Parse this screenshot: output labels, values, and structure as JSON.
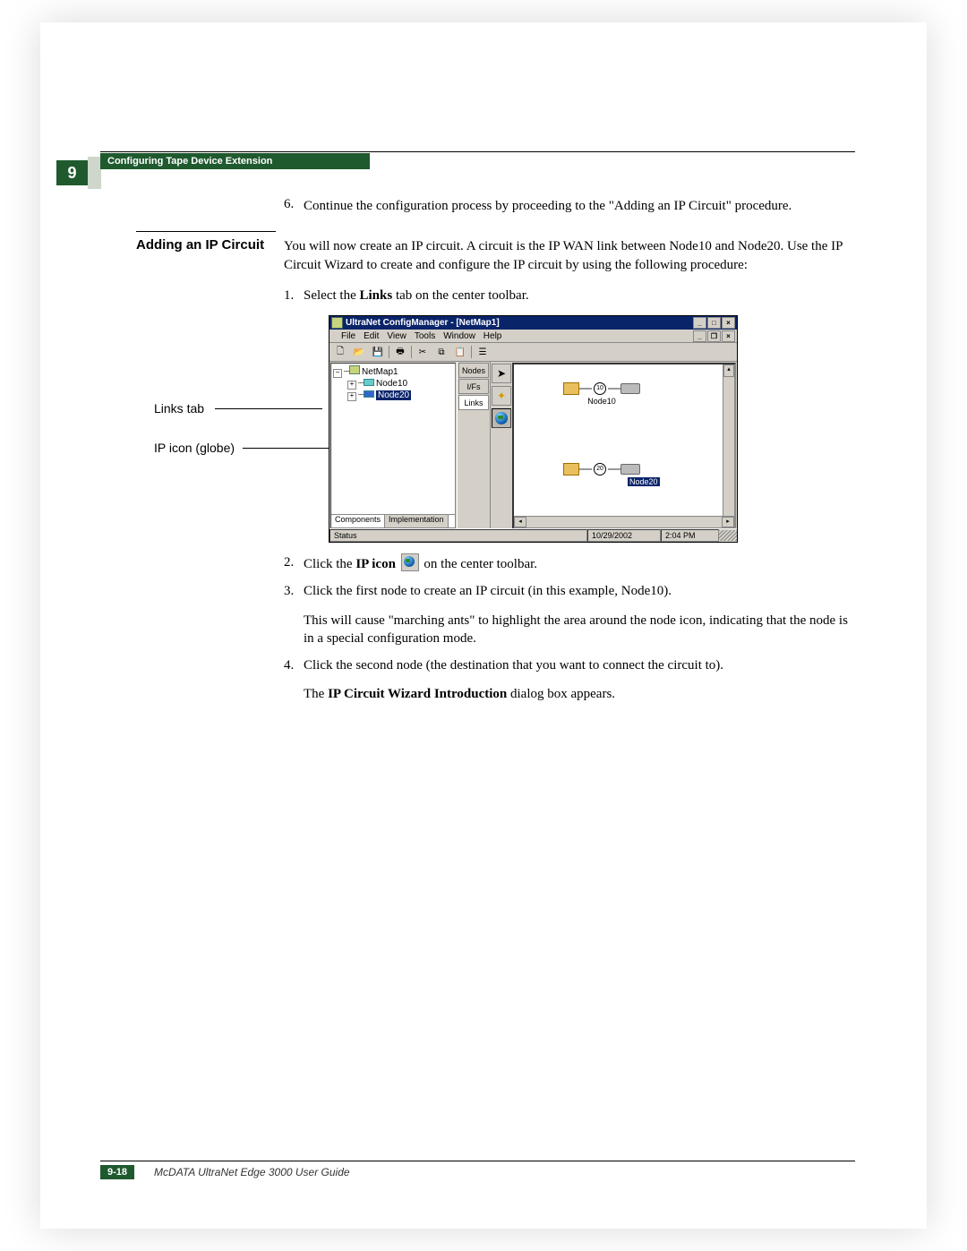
{
  "chapter_number": "9",
  "header_title": "Configuring Tape Device Extension",
  "step6_num": "6.",
  "step6_text": "Continue the configuration process by proceeding to the \"Adding an IP Circuit\" procedure.",
  "section_heading": "Adding an IP Circuit",
  "intro": "You will now create an IP circuit. A circuit is the IP WAN link between Node10 and Node20. Use the IP Circuit Wizard to create and configure the IP circuit by using the following procedure:",
  "steps": {
    "s1_num": "1.",
    "s1_a": "Select the ",
    "s1_bold": "Links",
    "s1_b": " tab on the center toolbar.",
    "s2_num": "2.",
    "s2_a": "Click the ",
    "s2_bold": "IP icon",
    "s2_b": " on the center toolbar.",
    "s3_num": "3.",
    "s3_text": "Click the first node to create an IP circuit (in this example, Node10).",
    "s3_p2": "This will cause \"marching ants\" to highlight the area around the node icon, indicating that the node is in a special configuration mode.",
    "s4_num": "4.",
    "s4_text": "Click the second node (the destination that you want to connect the circuit to).",
    "s4_p2a": "The ",
    "s4_p2bold": "IP Circuit Wizard Introduction",
    "s4_p2b": " dialog box appears."
  },
  "callouts": {
    "links_tab": "Links tab",
    "ip_icon": "IP icon (globe)"
  },
  "screenshot": {
    "title": "UltraNet ConfigManager - [NetMap1]",
    "menus": [
      "File",
      "Edit",
      "View",
      "Tools",
      "Window",
      "Help"
    ],
    "tree_root": "NetMap1",
    "tree_n1": "Node10",
    "tree_n2": "Node20",
    "tree_tab1": "Components",
    "tree_tab2": "Implementation",
    "vtab1": "Nodes",
    "vtab2": "I/Fs",
    "vtab3": "Links",
    "node10_num": "10",
    "node10_label": "Node10",
    "node20_num": "20",
    "node20_label": "Node20",
    "status_label": "Status",
    "status_date": "10/29/2002",
    "status_time": "2:04 PM"
  },
  "footer": {
    "page": "9-18",
    "guide": "McDATA UltraNet Edge 3000 User Guide"
  }
}
